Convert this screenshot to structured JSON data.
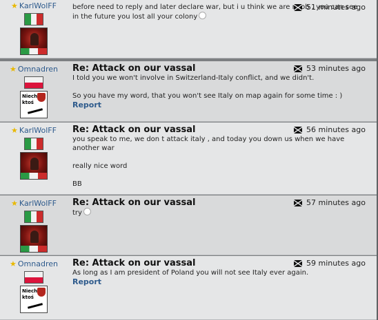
{
  "posts": [
    {
      "author": "KarlWolFF",
      "nation": "it",
      "title": "",
      "time": "51 minutes ago",
      "lines": [
        "before need to reply and later declare war, but i u think we are noob , you can see",
        "in the future you lost all your colony"
      ],
      "smiley": true,
      "report": ""
    },
    {
      "author": "Omnadren",
      "nation": "pl",
      "title": "Re: Attack on our vassal",
      "time": "53 minutes ago",
      "lines": [
        "I told you we won't involve in Switzerland-Italy conflict, and we didn't.",
        "",
        "So you have my word, that you won't see Italy on map again for some time : )"
      ],
      "report": "Report"
    },
    {
      "author": "KarlWolFF",
      "nation": "it",
      "title": "Re: Attack on our vassal",
      "time": "56 minutes ago",
      "lines": [
        "you speak to me, we don t attack italy , and today you down us when we have",
        "another war",
        "",
        "really nice word",
        "",
        "BB"
      ],
      "report": ""
    },
    {
      "author": "KarlWolFF",
      "nation": "it",
      "title": "Re: Attack on our vassal",
      "time": "57 minutes ago",
      "lines": [
        "try"
      ],
      "smiley": true,
      "report": ""
    },
    {
      "author": "Omnadren",
      "nation": "pl",
      "title": "Re: Attack on our vassal",
      "time": "59 minutes ago",
      "lines": [
        "As long as I am president of Poland you will not see Italy ever again."
      ],
      "report": "Report"
    }
  ],
  "avatar_text_pl": "Niech ktoś",
  "colors": {
    "author": "#2d5a8c",
    "star": "#e8b800",
    "italy": [
      "#2b9a45",
      "#f2f2f2",
      "#cc2c2c"
    ],
    "poland": [
      "#f2f2f2",
      "#dc143c"
    ]
  }
}
